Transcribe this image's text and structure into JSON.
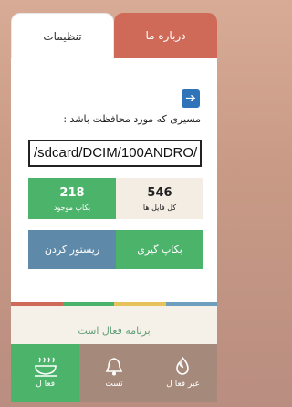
{
  "tabs": {
    "settings": "تنظیمات",
    "about": "درباره ما"
  },
  "form": {
    "path_label": "مسیری که مورد محافظت باشد :",
    "path_value": "/sdcard/DCIM/100ANDRO/"
  },
  "stats": {
    "available_count": "218",
    "available_label": "بکاپ موجود",
    "total_count": "546",
    "total_label": "کل فایل ها"
  },
  "actions": {
    "backup": "بکاپ گیری",
    "restore": "ریستور کردن"
  },
  "status": {
    "text": "برنامه فعال است"
  },
  "nav": {
    "active": "فعا ل",
    "test": "تست",
    "inactive": "غیر فعا ل"
  },
  "colors": {
    "accent_green": "#4bb36a",
    "tab_red": "#d06a58",
    "arrow_blue": "#2f73b8",
    "restore_blue": "#5e89a8",
    "stripe": [
      "#cf6a5b",
      "#4bb36a",
      "#e7c15a",
      "#6f9fbf"
    ]
  },
  "icons": {
    "arrow": "arrow-right-icon",
    "active": "dish-icon",
    "test": "bell-icon",
    "inactive": "fire-icon"
  }
}
